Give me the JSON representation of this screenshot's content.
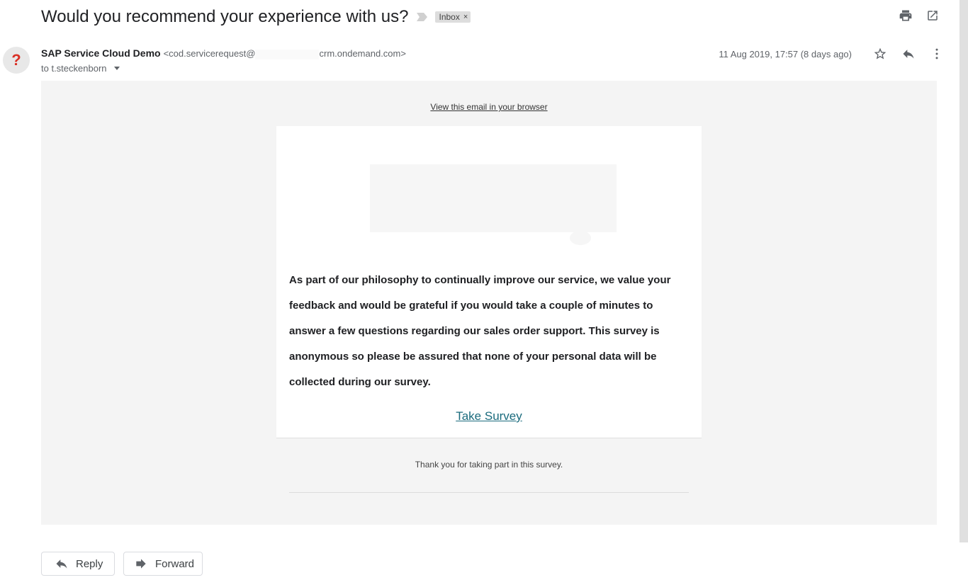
{
  "subject": "Would you recommend your experience with us?",
  "label": {
    "name": "Inbox",
    "remove": "×"
  },
  "sender": {
    "name": "SAP Service Cloud Demo",
    "email_start": "<cod.servicerequest@",
    "email_end": "crm.ondemand.com>",
    "avatar_glyph": "?"
  },
  "recipient": "to t.steckenborn",
  "date": "11 Aug 2019, 17:57 (8 days ago)",
  "body": {
    "view_link": "View this email in your browser",
    "paragraph": "As part of our philosophy to continually improve our service, we value your feedback and would be grateful if you would take a couple of minutes to answer a few questions regarding our sales order support. This survey is anonymous so please be assured that none of your personal data will be collected during our survey.",
    "survey_link": "Take Survey",
    "thanks": "Thank you for taking part in this survey."
  },
  "actions": {
    "reply": "Reply",
    "forward": "Forward"
  },
  "colors": {
    "link": "#1a6b7d",
    "avatar_glyph": "#d93025",
    "body_bg": "#f4f4f4"
  },
  "icons": [
    "importance-marker-icon",
    "print-icon",
    "open-new-window-icon",
    "star-icon",
    "reply-icon",
    "more-vert-icon",
    "forward-icon"
  ]
}
